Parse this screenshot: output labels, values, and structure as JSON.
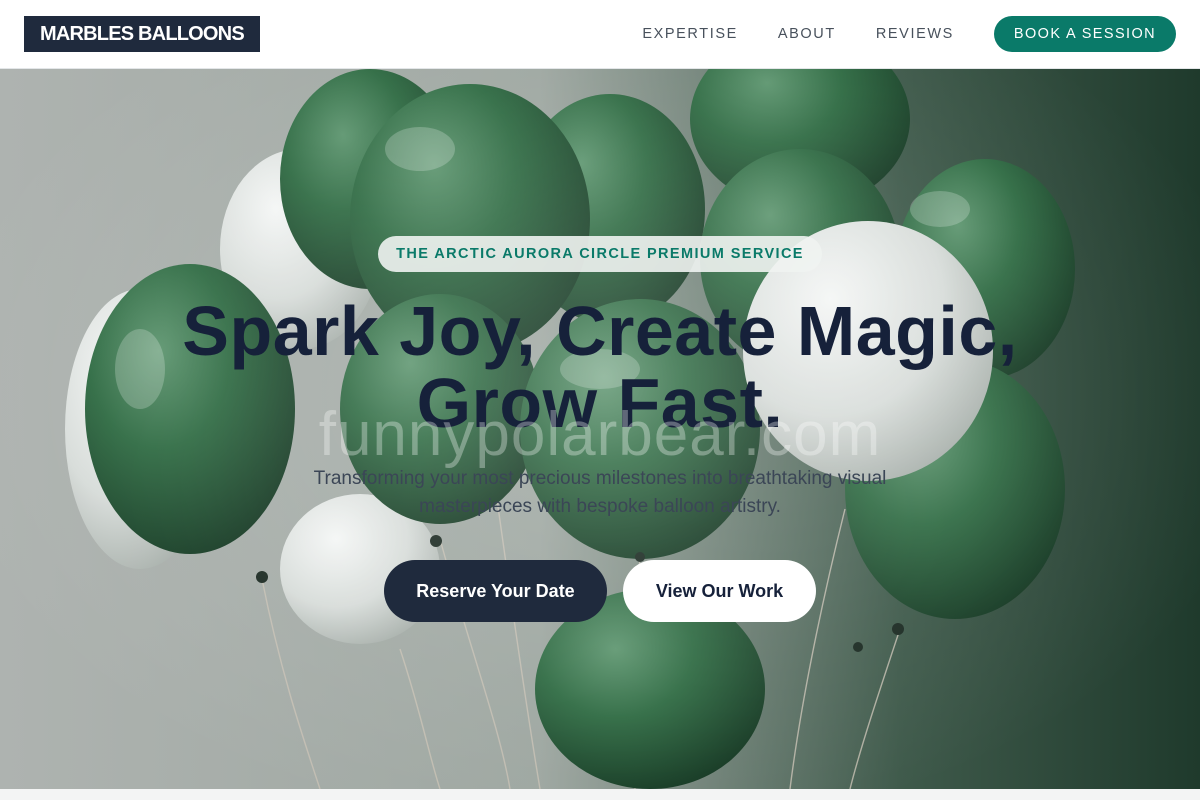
{
  "header": {
    "logo": "MARBLES BALLOONS",
    "nav": [
      {
        "label": "EXPERTISE"
      },
      {
        "label": "ABOUT"
      },
      {
        "label": "REVIEWS"
      }
    ],
    "cta_label": "BOOK A SESSION"
  },
  "hero": {
    "badge": "THE ARCTIC AURORA CIRCLE PREMIUM SERVICE",
    "headline_line1": "Spark Joy, Create Magic,",
    "headline_line2": "Grow Fast.",
    "watermark": "funnypolarbear.com",
    "subtext": "Transforming your most precious milestones into breathtaking visual masterpieces with bespoke balloon artistry.",
    "primary_button": "Reserve Your Date",
    "secondary_button": "View Our Work"
  },
  "colors": {
    "brand_dark": "#1f2a3d",
    "accent_teal": "#0a7a69",
    "balloon_green": "#2f6b43",
    "balloon_white": "#e4e7e5"
  }
}
